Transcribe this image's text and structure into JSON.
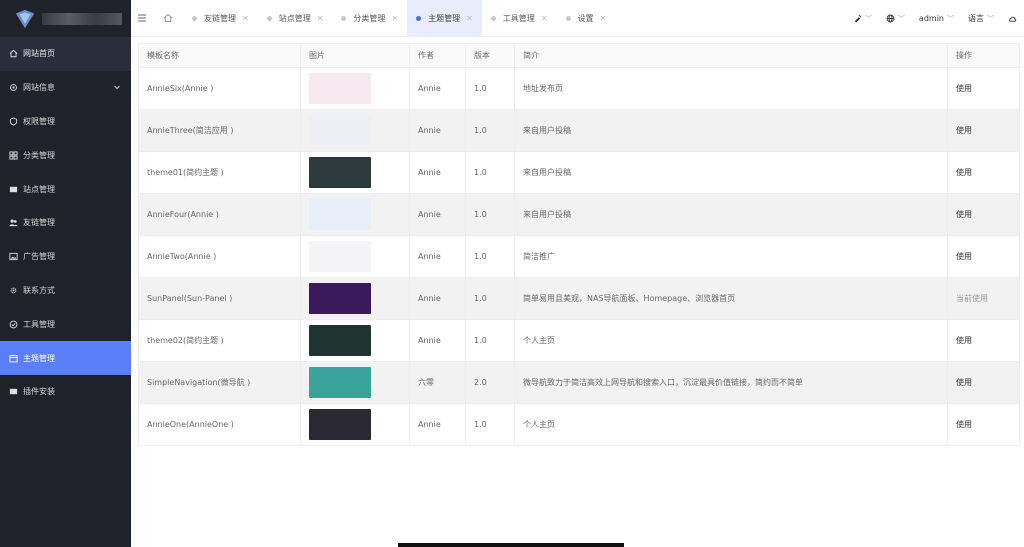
{
  "sidebar": {
    "items": [
      {
        "label": "网站首页",
        "icon": "home-icon"
      },
      {
        "label": "网站信息",
        "icon": "settings-icon"
      },
      {
        "label": "权限管理",
        "icon": "shield-icon"
      },
      {
        "label": "分类管理",
        "icon": "grid-icon"
      },
      {
        "label": "站点管理",
        "icon": "window-icon"
      },
      {
        "label": "友链管理",
        "icon": "users-icon"
      },
      {
        "label": "广告管理",
        "icon": "image-icon"
      },
      {
        "label": "联系方式",
        "icon": "gear-icon"
      },
      {
        "label": "工具管理",
        "icon": "check-shield-icon"
      },
      {
        "label": "主题管理",
        "icon": "calendar-icon"
      },
      {
        "label": "插件安装",
        "icon": "plugin-icon"
      }
    ]
  },
  "tabs": [
    {
      "label": "友链管理"
    },
    {
      "label": "站点管理"
    },
    {
      "label": "分类管理"
    },
    {
      "label": "主题管理"
    },
    {
      "label": "工具管理"
    },
    {
      "label": "设置"
    }
  ],
  "topbar": {
    "user": "admin",
    "language": "语言"
  },
  "table": {
    "headers": [
      "模板名称",
      "图片",
      "作者",
      "版本",
      "简介",
      "操作"
    ],
    "rows": [
      {
        "name": "AnnieSix(Annie )",
        "author": "Annie",
        "version": "1.0",
        "desc": "地址发布页",
        "action": "使用",
        "thumb": "#f7e9f0"
      },
      {
        "name": "AnnieThree(简洁应用 )",
        "author": "Annie",
        "version": "1.0",
        "desc": "来自用户投稿",
        "action": "使用",
        "thumb": "#eef0f5"
      },
      {
        "name": "theme01(简约主题 )",
        "author": "Annie",
        "version": "1.0",
        "desc": "来自用户投稿",
        "action": "使用",
        "thumb": "#2d3a3c"
      },
      {
        "name": "AnnieFour(Annie )",
        "author": "Annie",
        "version": "1.0",
        "desc": "来自用户投稿",
        "action": "使用",
        "thumb": "#e8eef8"
      },
      {
        "name": "AnnieTwo(Annie )",
        "author": "Annie",
        "version": "1.0",
        "desc": "简洁推广",
        "action": "使用",
        "thumb": "#f4f4f6"
      },
      {
        "name": "SunPanel(Sun-Panel )",
        "author": "Annie",
        "version": "1.0",
        "desc": "简单易用且美观，NAS导航面板、Homepage、浏览器首页",
        "action": "当前使用",
        "thumb": "#3a1a5a"
      },
      {
        "name": "theme02(简约主题 )",
        "author": "Annie",
        "version": "1.0",
        "desc": "个人主页",
        "action": "使用",
        "thumb": "#1f3430"
      },
      {
        "name": "SimpleNavigation(微导航 )",
        "author": "六零",
        "version": "2.0",
        "desc": "微导航致力于简洁高效上网导航和搜索入口，沉淀最具价值链接，简约而不简单",
        "action": "使用",
        "thumb": "#3aa49a"
      },
      {
        "name": "AnnieOne(AnnieOne )",
        "author": "Annie",
        "version": "1.0",
        "desc": "个人主页",
        "action": "使用",
        "thumb": "#2b2a34"
      }
    ]
  }
}
